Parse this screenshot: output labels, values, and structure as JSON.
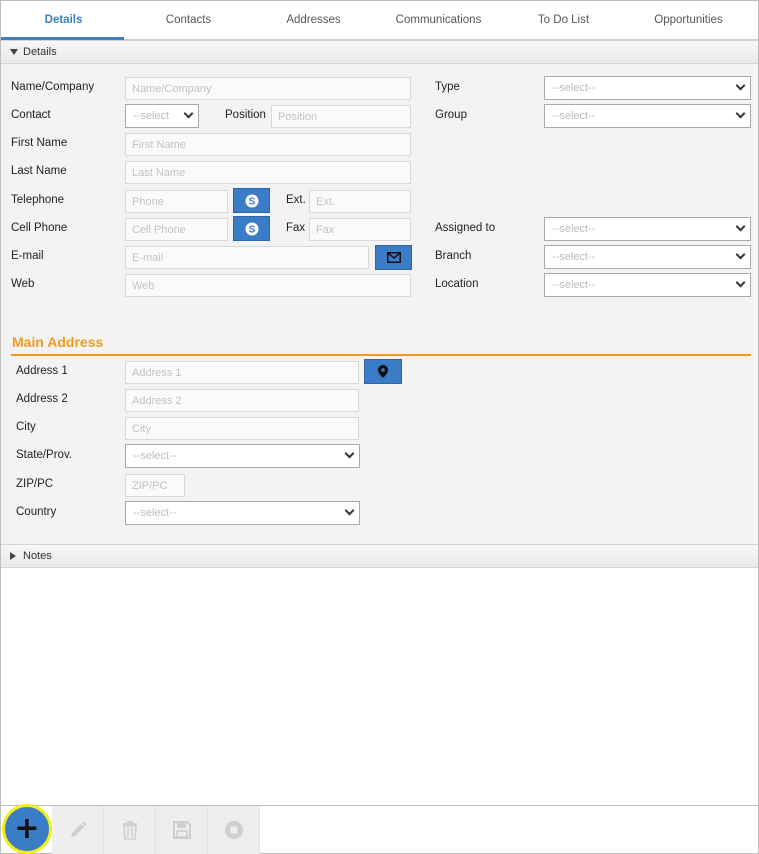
{
  "tabs": [
    "Details",
    "Contacts",
    "Addresses",
    "Communications",
    "To Do List",
    "Opportunities"
  ],
  "details_section": {
    "title": "Details"
  },
  "fields": {
    "name_company": {
      "label": "Name/Company",
      "placeholder": "Name/Company"
    },
    "contact": {
      "label": "Contact",
      "value": "--select"
    },
    "position": {
      "label": "Position",
      "placeholder": "Position"
    },
    "first_name": {
      "label": "First Name",
      "placeholder": "First Name"
    },
    "last_name": {
      "label": "Last Name",
      "placeholder": "Last Name"
    },
    "telephone": {
      "label": "Telephone",
      "placeholder": "Phone"
    },
    "ext": {
      "label": "Ext.",
      "placeholder": "Ext."
    },
    "cell_phone": {
      "label": "Cell Phone",
      "placeholder": "Cell Phone"
    },
    "fax": {
      "label": "Fax",
      "placeholder": "Fax"
    },
    "email": {
      "label": "E-mail",
      "placeholder": "E-mail"
    },
    "web": {
      "label": "Web",
      "placeholder": "Web"
    },
    "type": {
      "label": "Type",
      "value": "--select--"
    },
    "group": {
      "label": "Group",
      "value": "--select--"
    },
    "assigned_to": {
      "label": "Assigned to",
      "value": "--select--"
    },
    "branch": {
      "label": "Branch",
      "value": "--select--"
    },
    "location": {
      "label": "Location",
      "value": "--select--"
    }
  },
  "main_address": {
    "title": "Main Address",
    "address1": {
      "label": "Address 1",
      "placeholder": "Address 1"
    },
    "address2": {
      "label": "Address 2",
      "placeholder": "Address 2"
    },
    "city": {
      "label": "City",
      "placeholder": "City"
    },
    "state": {
      "label": "State/Prov.",
      "value": "--select--"
    },
    "zip": {
      "label": "ZIP/PC",
      "placeholder": "ZIP/PC"
    },
    "country": {
      "label": "Country",
      "value": "--select--"
    }
  },
  "notes_section": {
    "title": "Notes"
  },
  "toolbar": [
    "add",
    "edit",
    "delete",
    "save",
    "cancel"
  ],
  "icons": [
    "skype-icon",
    "skype-icon",
    "envelope-icon",
    "map-pin-icon",
    "plus-icon",
    "pencil-icon",
    "trash-icon",
    "floppy-disk-icon",
    "stop-icon"
  ],
  "colors": {
    "accent": "#3a7cc6",
    "orange": "#f39a1b",
    "highlight": "#f1ee1a"
  }
}
